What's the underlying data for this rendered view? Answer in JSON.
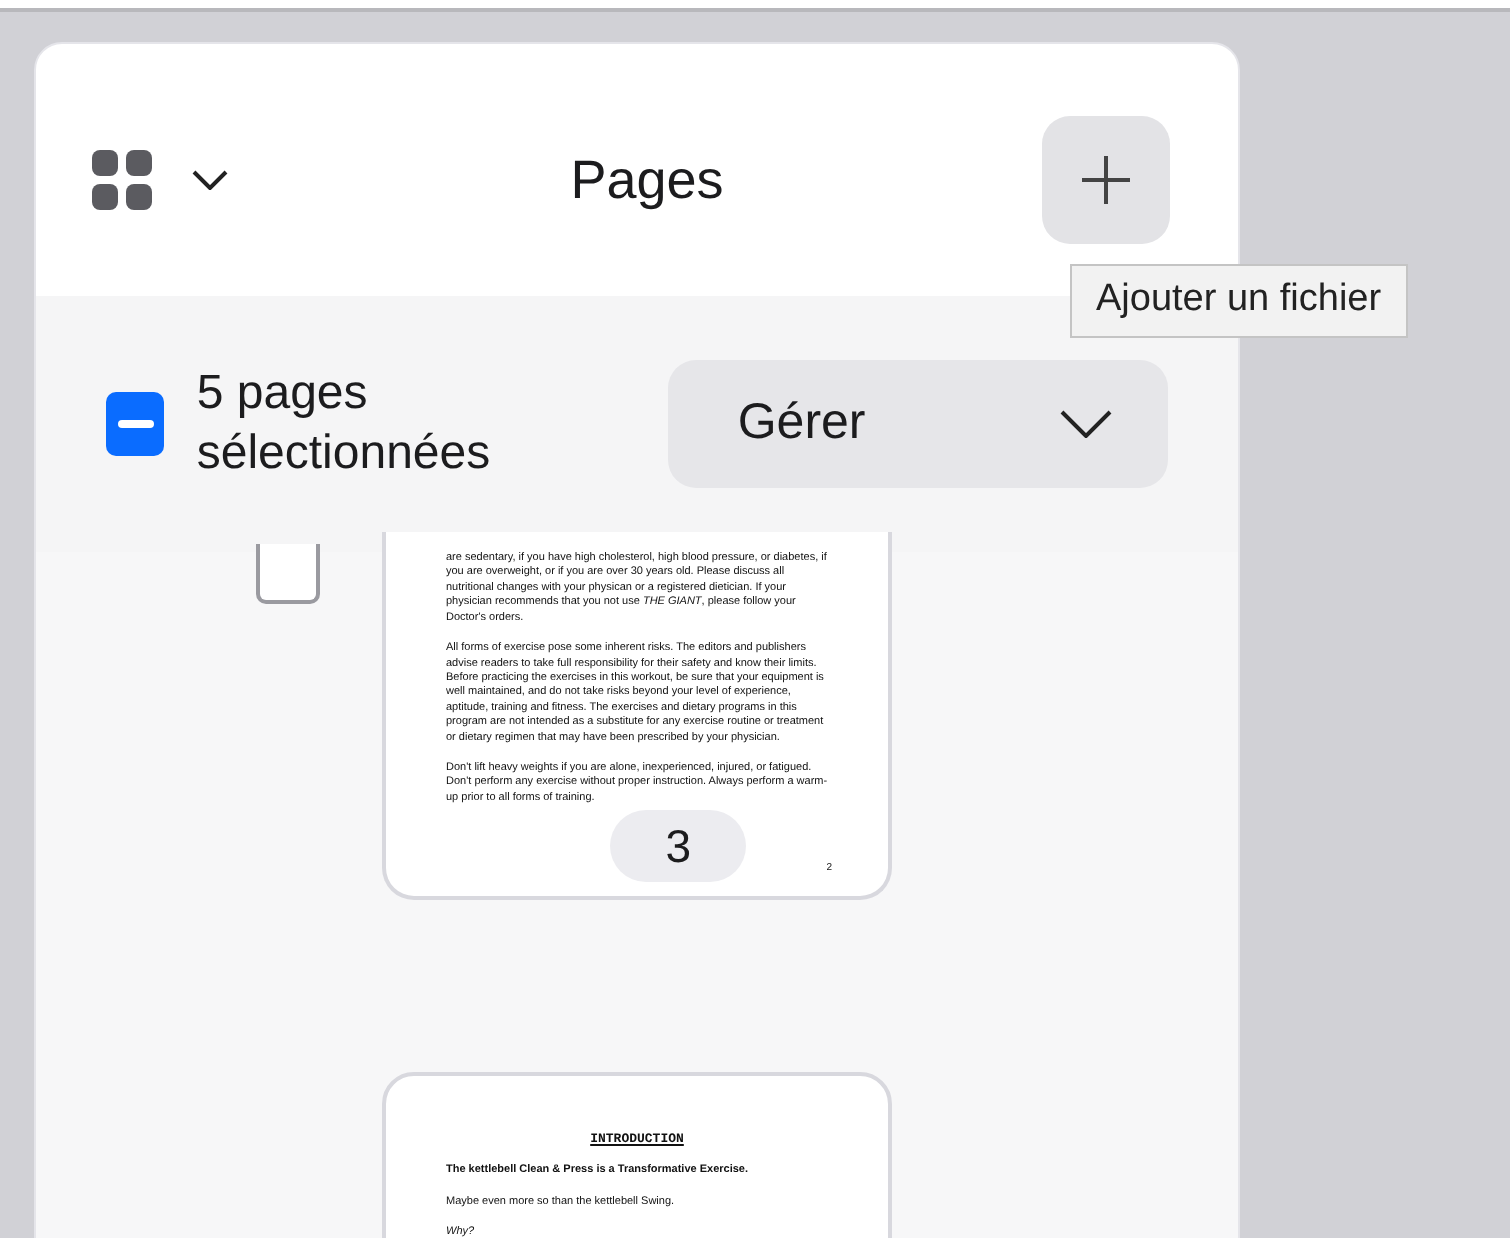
{
  "header": {
    "title": "Pages",
    "add_tooltip": "Ajouter un fichier"
  },
  "selection": {
    "indeterminate": true,
    "label": "5 pages sélectionnées",
    "manage_button": "Gérer"
  },
  "pages": [
    {
      "checkbox_checked": false,
      "badge": "3",
      "footer": "2",
      "blocks": [
        {
          "kind": "plain",
          "text": "are sedentary, if you have high cholesterol, high blood pressure, or diabetes, if you are overweight, or if you are over 30 years old. Please discuss all nutritional changes with your physican or a registered dietician. If your physician recommends that you not use *THE GIANT*, please follow your Doctor's orders."
        },
        {
          "kind": "plain",
          "text": "All forms of exercise pose some inherent risks. The editors and publishers advise readers to take full responsibility for their safety and know their limits. Before practicing the exercises in this workout, be sure that your equipment is well maintained, and do not take risks beyond your level of experience, aptitude, training and fitness. The exercises and dietary programs in this program are not intended as a substitute for any exercise routine or treatment or dietary regimen that may have been prescribed by your physician."
        },
        {
          "kind": "plain",
          "text": "Don't lift heavy weights if you are alone, inexperienced, injured, or fatigued. Don't perform any exercise without proper instruction. Always perform a warm-up prior to all forms of training."
        }
      ]
    },
    {
      "blocks": [
        {
          "kind": "heading",
          "text": "INTRODUCTION"
        },
        {
          "kind": "bold",
          "text": "The kettlebell Clean & Press is a Transformative Exercise."
        },
        {
          "kind": "plain",
          "text": "Maybe even more so than the kettlebell Swing."
        },
        {
          "kind": "italic",
          "text": "Why?"
        }
      ]
    }
  ]
}
